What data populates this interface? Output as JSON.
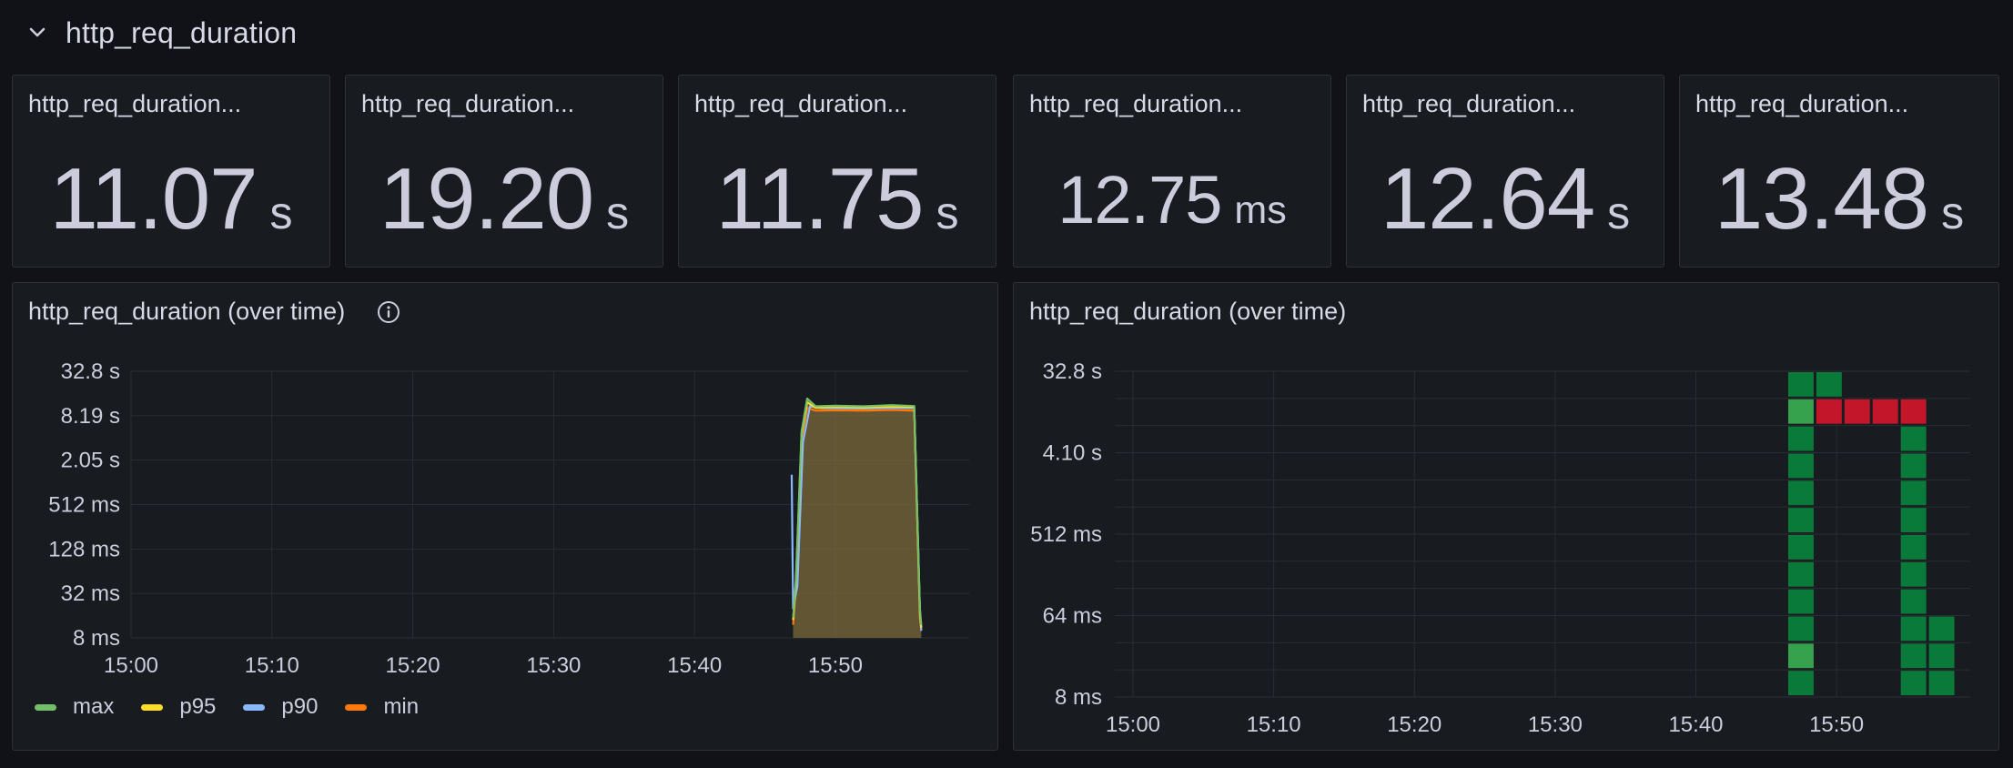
{
  "row": {
    "title": "http_req_duration"
  },
  "stats": [
    {
      "title": "http_req_duration...",
      "value": "11.07",
      "unit": "s"
    },
    {
      "title": "http_req_duration...",
      "value": "19.20",
      "unit": "s"
    },
    {
      "title": "http_req_duration...",
      "value": "11.75",
      "unit": "s"
    },
    {
      "title": "http_req_duration...",
      "value": "12.75",
      "unit": "ms"
    },
    {
      "title": "http_req_duration...",
      "value": "12.64",
      "unit": "s"
    },
    {
      "title": "http_req_duration...",
      "value": "13.48",
      "unit": "s"
    }
  ],
  "colors": {
    "max": "#73bf69",
    "p95": "#fade2a",
    "p90": "#8ab8ff",
    "min": "#ff780a",
    "heat_green": "#0a7a3a",
    "heat_green_light": "#37a24e",
    "heat_red": "#c4162a"
  },
  "chart_data": [
    {
      "type": "line",
      "title": "http_req_duration (over time)",
      "y_scale": "log",
      "y_ticks": [
        "32.8 s",
        "8.19 s",
        "2.05 s",
        "512 ms",
        "128 ms",
        "32 ms",
        "8 ms"
      ],
      "x_ticks": [
        "15:00",
        "15:10",
        "15:20",
        "15:30",
        "15:40",
        "15:50"
      ],
      "ylim_seconds": [
        0.008,
        32.8
      ],
      "x_range_minutes": [
        0,
        59.5
      ],
      "series": [
        {
          "name": "max",
          "x": [
            47.0,
            47.2,
            47.6,
            48.0,
            48.6,
            50.0,
            52.0,
            54.0,
            55.6,
            56.0,
            56.1
          ],
          "y": [
            0.015,
            0.05,
            5.0,
            14.0,
            11.0,
            11.2,
            11.0,
            11.4,
            11.1,
            0.02,
            0.012
          ]
        },
        {
          "name": "p95",
          "x": [
            47.0,
            47.2,
            47.6,
            48.0,
            48.6,
            50.0,
            52.0,
            54.0,
            55.6,
            56.0,
            56.1
          ],
          "y": [
            0.014,
            0.045,
            4.6,
            12.5,
            10.5,
            10.8,
            10.6,
            10.9,
            10.7,
            0.018,
            0.011
          ]
        },
        {
          "name": "p90",
          "x": [
            46.9,
            47.0,
            47.3,
            47.7,
            48.2,
            49.0,
            52.0,
            54.0,
            55.6,
            56.0,
            56.1
          ],
          "y": [
            1.3,
            0.02,
            0.04,
            3.6,
            11.0,
            10.4,
            10.3,
            10.5,
            10.4,
            0.02,
            0.01
          ]
        },
        {
          "name": "min",
          "x": [
            47.0,
            47.2,
            47.6,
            48.0,
            48.6,
            50.0,
            52.0,
            54.0,
            55.6,
            56.0,
            56.1
          ],
          "y": [
            0.012,
            0.04,
            4.0,
            10.5,
            9.6,
            9.7,
            9.6,
            9.8,
            9.6,
            0.015,
            0.01
          ]
        }
      ],
      "legend": [
        "max",
        "p95",
        "p90",
        "min"
      ],
      "legend_position": "bottom",
      "info_icon": "info-icon"
    },
    {
      "type": "heatmap",
      "title": "http_req_duration (over time)",
      "y_scale": "log",
      "y_ticks": [
        "32.8 s",
        "4.10 s",
        "512 ms",
        "64 ms",
        "8 ms"
      ],
      "x_ticks": [
        "15:00",
        "15:10",
        "15:20",
        "15:30",
        "15:40",
        "15:50"
      ],
      "x_range_minutes": [
        0,
        59.5
      ],
      "buckets": [
        {
          "x": 46.5,
          "bands": [
            0,
            1,
            2,
            3,
            4,
            5,
            6,
            7,
            8,
            9,
            10,
            11
          ],
          "light": [
            1,
            10
          ]
        },
        {
          "x": 48.5,
          "bands": [
            11
          ],
          "red": [
            10
          ]
        },
        {
          "x": 50.5,
          "bands": [],
          "red": [
            10
          ]
        },
        {
          "x": 52.5,
          "bands": [],
          "red": [
            10
          ]
        },
        {
          "x": 54.5,
          "bands": [
            0,
            1,
            2,
            3,
            4,
            5,
            6,
            7,
            8,
            9
          ],
          "red": [
            10
          ]
        },
        {
          "x": 56.5,
          "bands": [
            0,
            1,
            2
          ]
        }
      ]
    }
  ]
}
